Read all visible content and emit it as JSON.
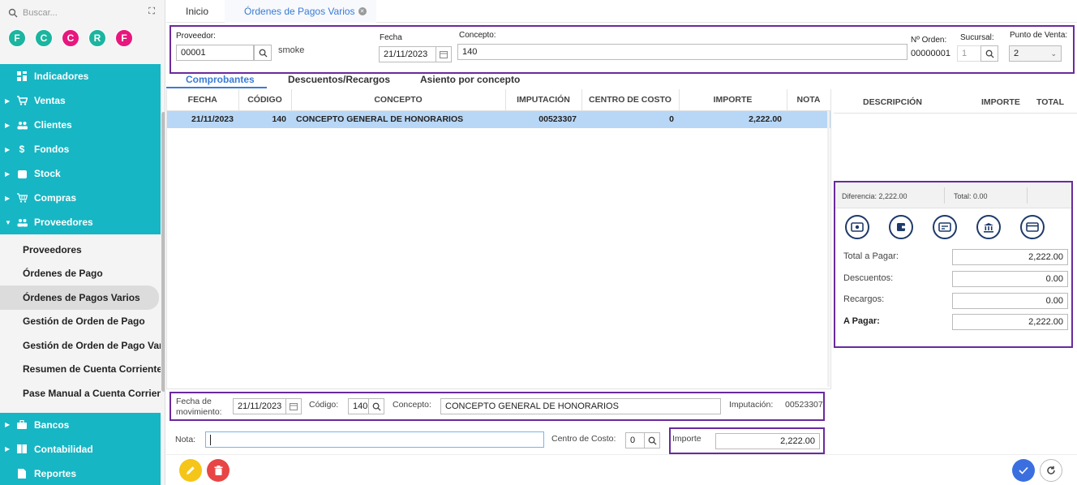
{
  "sidebar": {
    "search_placeholder": "Buscar...",
    "avatars": [
      {
        "letter": "F",
        "color": "#1bb5a0"
      },
      {
        "letter": "C",
        "color": "#1bb5a0"
      },
      {
        "letter": "C",
        "color": "#e8177d"
      },
      {
        "letter": "R",
        "color": "#1bb5a0"
      },
      {
        "letter": "F",
        "color": "#e8177d"
      }
    ],
    "menu": [
      {
        "label": "Indicadores",
        "icon": "dashboard-icon"
      },
      {
        "label": "Ventas",
        "icon": "cart-icon"
      },
      {
        "label": "Clientes",
        "icon": "users-icon"
      },
      {
        "label": "Fondos",
        "icon": "dollar-icon"
      },
      {
        "label": "Stock",
        "icon": "box-icon"
      },
      {
        "label": "Compras",
        "icon": "basket-icon"
      },
      {
        "label": "Proveedores",
        "icon": "users-icon"
      }
    ],
    "submenu": [
      "Proveedores",
      "Órdenes de Pago",
      "Órdenes de Pagos Varios",
      "Gestión de Orden de Pago",
      "Gestión de Orden de Pago Varios",
      "Resumen de Cuenta Corriente",
      "Pase Manual a Cuenta Corriente"
    ],
    "menu_bottom": [
      {
        "label": "Bancos",
        "icon": "briefcase-icon"
      },
      {
        "label": "Contabilidad",
        "icon": "book-icon"
      },
      {
        "label": "Reportes",
        "icon": "report-icon"
      }
    ]
  },
  "tabs": {
    "home": "Inicio",
    "active": "Órdenes de Pagos Varios"
  },
  "header": {
    "proveedor_label": "Proveedor:",
    "proveedor_code": "00001",
    "proveedor_name": "smoke",
    "fecha_label": "Fecha",
    "fecha_value": "21/11/2023",
    "concepto_label": "Concepto:",
    "concepto_value": "140",
    "orden_label": "Nº Orden:",
    "orden_value": "00000001",
    "sucursal_label": "Sucursal:",
    "sucursal_value": "1",
    "pv_label": "Punto de Venta:",
    "pv_value": "2"
  },
  "subtabs": [
    "Comprobantes",
    "Descuentos/Recargos",
    "Asiento por concepto"
  ],
  "grid": {
    "columns": [
      "FECHA",
      "CÓDIGO",
      "CONCEPTO",
      "IMPUTACIÓN",
      "CENTRO DE COSTO",
      "IMPORTE",
      "NOTA"
    ],
    "rows": [
      [
        "21/11/2023",
        "140",
        "CONCEPTO GENERAL DE HONORARIOS",
        "00523307",
        "0",
        "2,222.00",
        ""
      ]
    ]
  },
  "rgrid": {
    "columns": [
      "DESCRIPCIÓN",
      "IMPORTE",
      "TOTAL"
    ]
  },
  "payment": {
    "diferencia": "Diferencia: 2,222.00",
    "total": "Total: 0.00",
    "icons": [
      "cash-icon",
      "wallet-icon",
      "check-icon",
      "bank-icon",
      "card-icon"
    ],
    "total_pagar_label": "Total a Pagar:",
    "total_pagar_value": "2,222.00",
    "descuentos_label": "Descuentos:",
    "descuentos_value": "0.00",
    "recargos_label": "Recargos:",
    "recargos_value": "0.00",
    "a_pagar_label": "A Pagar:",
    "a_pagar_value": "2,222.00"
  },
  "movimiento": {
    "fecha_label": "Fecha de movimiento:",
    "fecha_value": "21/11/2023",
    "codigo_label": "Código:",
    "codigo_value": "140",
    "concepto_label": "Concepto:",
    "concepto_value": "CONCEPTO GENERAL DE HONORARIOS",
    "imputacion_label": "Imputación:",
    "imputacion_value": "00523307",
    "nota_label": "Nota:",
    "nota_value": "",
    "centro_label": "Centro de Costo:",
    "centro_value": "0",
    "importe_label": "Importe",
    "importe_value": "2,222.00"
  },
  "colors": {
    "sidebar_accent": "#17b6c4",
    "highlight_border": "#6a2a9c",
    "row_selected": "#b8d7f6",
    "link_blue": "#3a7bd5",
    "edit_button": "#f5c518",
    "delete_button": "#e84545",
    "confirm_button": "#3b6fe0"
  }
}
